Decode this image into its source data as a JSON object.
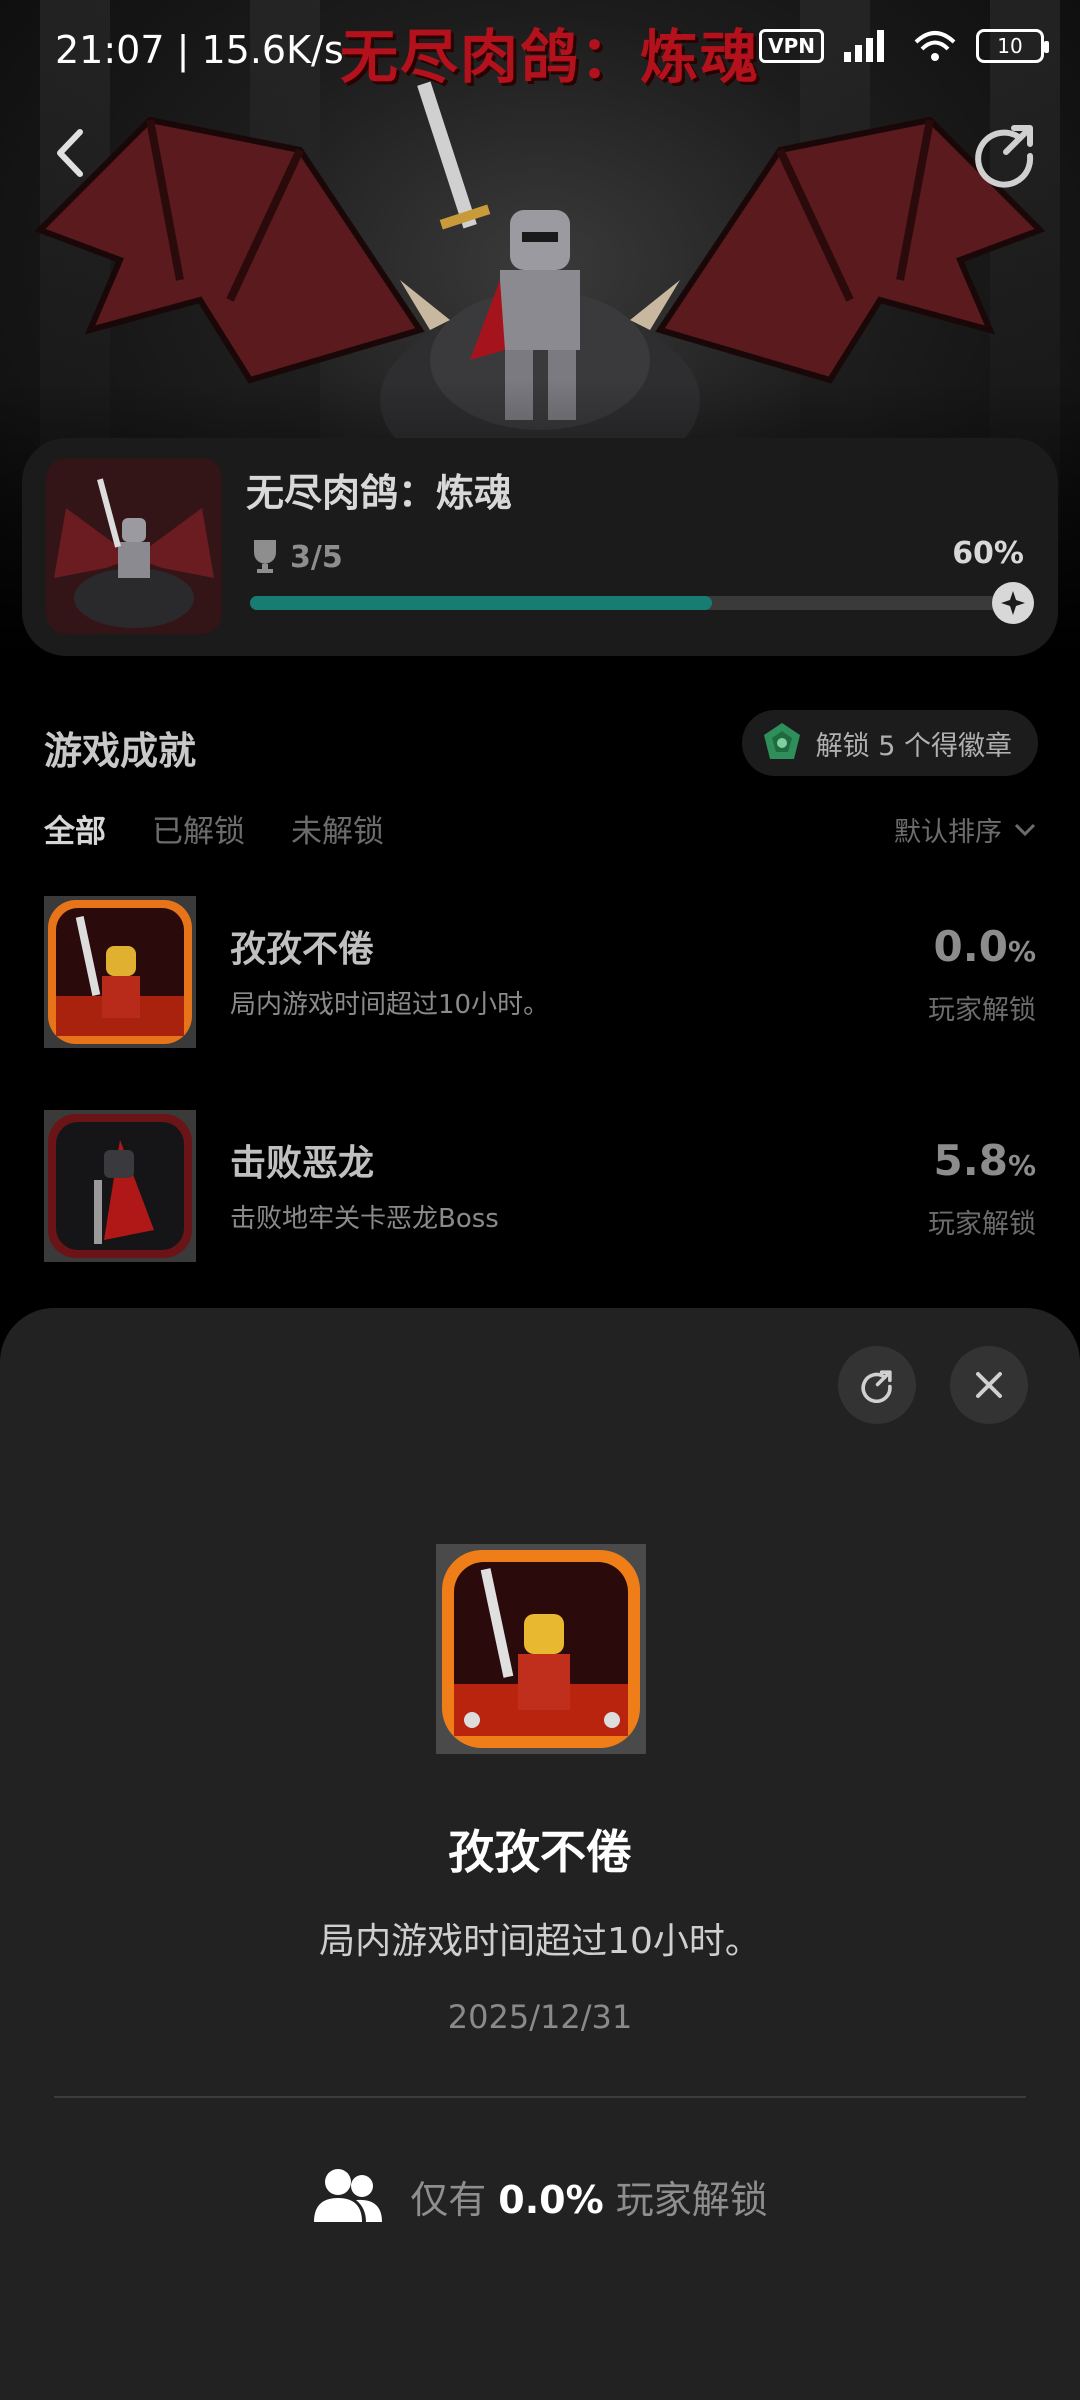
{
  "status_bar": {
    "time": "21:07",
    "speed": "15.6K/s",
    "vpn": "VPN",
    "battery": "10"
  },
  "hero": {
    "title": "无尽肉鸽：炼魂"
  },
  "game_card": {
    "name": "无尽肉鸽：炼魂",
    "progress_text": "3/5",
    "percent_label": "60%",
    "progress": 0.6
  },
  "achievements": {
    "title": "游戏成就",
    "badge_pill": "解锁 5 个得徽章",
    "tabs": [
      {
        "label": "全部"
      },
      {
        "label": "已解锁"
      },
      {
        "label": "未解锁"
      }
    ],
    "sort_label": "默认排序",
    "items": [
      {
        "name": "孜孜不倦",
        "desc": "局内游戏时间超过10小时。",
        "pct": "0.0",
        "pct_unit": "%",
        "pct_label": "玩家解锁"
      },
      {
        "name": "击败恶龙",
        "desc": "击败地牢关卡恶龙Boss",
        "pct": "5.8",
        "pct_unit": "%",
        "pct_label": "玩家解锁"
      }
    ]
  },
  "sheet": {
    "name": "孜孜不倦",
    "desc": "局内游戏时间超过10小时。",
    "date": "2025/12/31",
    "stat_prefix": "仅有",
    "stat_value": "0.0%",
    "stat_suffix": "玩家解锁"
  },
  "colors": {
    "progress": "#177c72",
    "hero_title": "#b3121c",
    "sheet_bg": "#222222"
  },
  "icons": [
    "back-icon",
    "share-icon",
    "trophy-icon",
    "compass-icon",
    "badge-icon",
    "chevron-down-icon",
    "close-icon",
    "people-icon"
  ]
}
